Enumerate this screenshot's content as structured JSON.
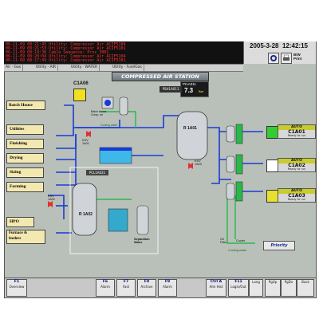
{
  "header": {
    "alarm_lines": [
      "06-11-09 08:21:45   Utility: Compressor Air  ACIF5104",
      "06-11-09 08:21:53   Utility: Compressor Air  ACIF5101",
      "06-11-09 08:19:38   Cable Sequence: Proc 3001",
      "06-11-09 08:20:04   Utility: Compressor Air  ACIF5104",
      "06-11-09 08:17:49   Utility: Compressor Air  ACIF5101"
    ],
    "date": "2005-3-28",
    "time": "12:42:15",
    "print_label": "B/W\nPrint",
    "tabs": [
      "Air · Gas",
      "Utility · AIR",
      "Utility · WATER",
      "Utility · Fuel/Gas"
    ]
  },
  "main": {
    "title": "COMPRESSED AIR STATION",
    "c1a06": "C1A06",
    "batch_comp": "Batch house\nComp. air",
    "cooling_water": "Cooling water",
    "pic_tag": "PI1A011",
    "pic_value": "7.3",
    "pic_unit": "Bar",
    "psh_tag": "PSH1A011",
    "ra01": "R 1A01",
    "ra02": "R 1A02",
    "ksv1": "KSV\n1A01",
    "ksv3": "KSV\n1A03",
    "ksv2": "KSV\n1A02",
    "pcl": "PCL1A021",
    "separation": "Separation\nWater",
    "oil_filter": "Oil\nFilter",
    "cooler": "Cooler",
    "cooling_water_2": "Cooling water",
    "priority": "Priority",
    "left_labels": [
      "Batch House",
      "Utilities",
      "Finishing",
      "Drying",
      "Sizing",
      "Forming"
    ],
    "hpo": "HPO",
    "furnace": "Furnace &\nfeeders",
    "controls": [
      {
        "header": "AUTO",
        "name": "C1A01",
        "status": "Ready to run",
        "color": "#33cc33"
      },
      {
        "header": "AUTO",
        "name": "C1A02",
        "status": "Ready to run",
        "color": "#ffffff"
      },
      {
        "header": "AUTO",
        "name": "C1A03",
        "status": "Ready to run",
        "color": "#e8e030"
      }
    ]
  },
  "footer": {
    "buttons": [
      {
        "key": "F1",
        "label": "Overview"
      },
      {
        "key": "F6",
        "label": "Alarm"
      },
      {
        "key": "F7",
        "label": "Fast"
      },
      {
        "key": "F8",
        "label": "Archive"
      },
      {
        "key": "F9",
        "label": "Alarm"
      },
      {
        "key": "Ctrl A",
        "label": "Alm Hist"
      },
      {
        "key": "F11",
        "label": "Login/Out"
      },
      {
        "key": "",
        "label": "Lang"
      },
      {
        "key": "",
        "label": "PgUp"
      },
      {
        "key": "",
        "label": "PgDn"
      },
      {
        "key": "",
        "label": "Back"
      }
    ]
  },
  "colors": {
    "screen_bg": "#b9c0b9",
    "alarm_text": "#ff3030",
    "pipe_air": "#1a3ad6",
    "pipe_water": "#2ab84a",
    "vessel": "#d0d4d8"
  }
}
